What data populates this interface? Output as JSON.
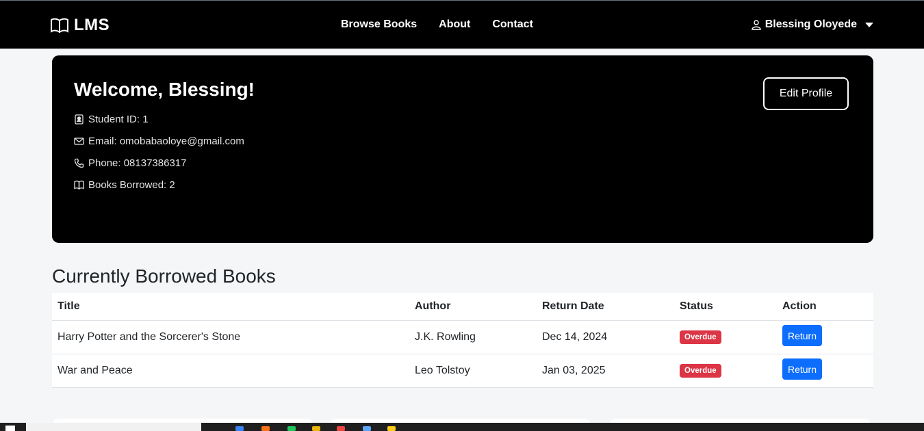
{
  "navbar": {
    "brand": "LMS",
    "links": [
      "Browse Books",
      "About",
      "Contact"
    ],
    "user_name": "Blessing Oloyede"
  },
  "profile": {
    "welcome": "Welcome, Blessing!",
    "edit_button": "Edit Profile",
    "student_id": "Student ID: 1",
    "email": "Email: omobabaoloye@gmail.com",
    "phone": "Phone: 08137386317",
    "books_borrowed": "Books Borrowed: 2"
  },
  "borrowed": {
    "title": "Currently Borrowed Books",
    "columns": [
      "Title",
      "Author",
      "Return Date",
      "Status",
      "Action"
    ],
    "rows": [
      {
        "title": "Harry Potter and the Sorcerer's Stone",
        "author": "J.K. Rowling",
        "return_date": "Dec 14, 2024",
        "status": "Overdue",
        "action": "Return"
      },
      {
        "title": "War and Peace",
        "author": "Leo Tolstoy",
        "return_date": "Jan 03, 2025",
        "status": "Overdue",
        "action": "Return"
      }
    ]
  },
  "colors": {
    "navbar_bg": "#000000",
    "status_overdue": "#dc3545",
    "button_primary": "#0d6efd"
  },
  "icons": [
    "book-icon",
    "user-icon",
    "id-badge-icon",
    "envelope-icon",
    "phone-icon",
    "book-open-icon",
    "caret-down-icon"
  ]
}
